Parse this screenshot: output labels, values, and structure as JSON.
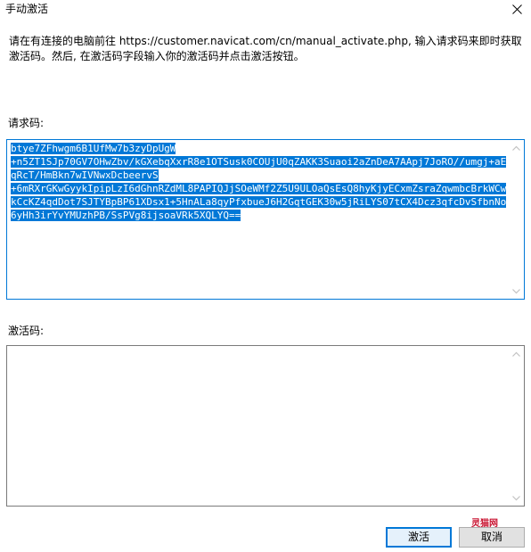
{
  "window": {
    "title": "手动激活",
    "close_icon": "close-icon"
  },
  "description": "请在有连接的电脑前往 https://customer.navicat.com/cn/manual_activate.php, 输入请求码来即时获取激活码。然后, 在激活码字段输入你的激活码并点击激活按钮。",
  "request": {
    "label": "请求码:",
    "value": "btye7ZFhwgm6B1UfMw7b3zyDpUgW\n+n5ZT1SJp70GV7OHwZbv/kGXebqXxrR8e1OTSusk0COUjU0qZAKK3Suaoi2aZnDeA7AApj7JoRO//umgj+aEqRcT/HmBkn7wIVNwxDcbeervS\n+6mRXrGKwGyykIpipLzI6dGhnRZdML8PAPIQJjSOeWMf2Z5U9ULOaQsEsQ8hyKjyECxmZsraZqwmbcBrkWCwkCcKZ4qdDot7SJTYBpBP61XDsx1+5HnALa8qyPfxbueJ6H2GqtGEK30w5jRiLYS07tCX4Dcz3qfcDvSfbnNo6yHh3irYvYMUzhPB/SsPVg8ijsoaVRk5XQLYQ=="
  },
  "activation": {
    "label": "激活码:",
    "value": ""
  },
  "watermark": "灵猫网",
  "buttons": {
    "activate": "激活",
    "cancel": "取消"
  },
  "colors": {
    "selection": "#0078d7",
    "focus_border": "#0078d7",
    "watermark": "#c8102e"
  }
}
